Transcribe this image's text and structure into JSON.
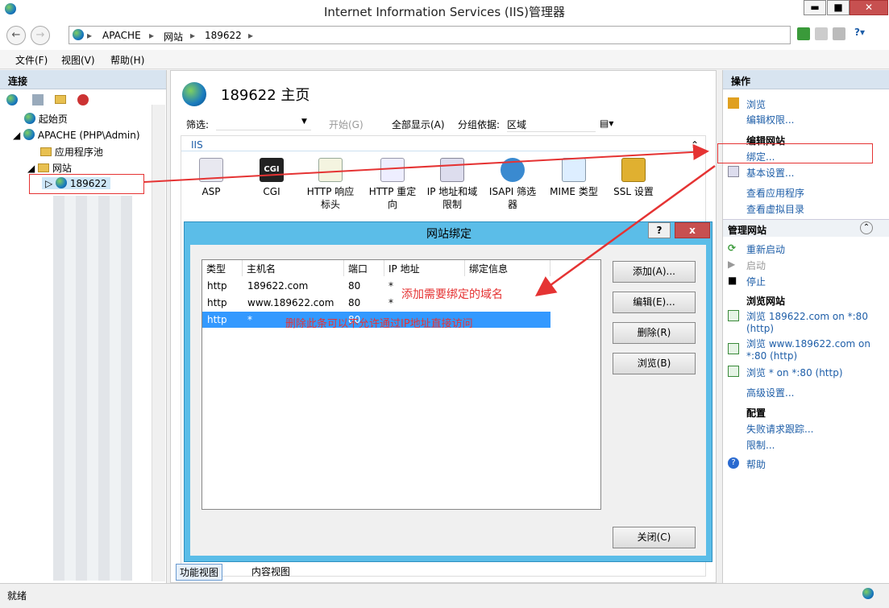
{
  "window": {
    "title": "Internet Information Services (IIS)管理器",
    "min": "▬",
    "max": "■",
    "close": "✕"
  },
  "nav": {
    "back": "←",
    "forward": "→",
    "crumbs": [
      "APACHE",
      "网站",
      "189622"
    ],
    "sep": "▸",
    "help": "?▾"
  },
  "menu": [
    "文件(F)",
    "视图(V)",
    "帮助(H)"
  ],
  "connections": {
    "header": "连接",
    "start_page": "起始页",
    "server": "APACHE (PHP\\Admin)",
    "app_pools": "应用程序池",
    "sites": "网站",
    "selected_site": "189622"
  },
  "center": {
    "title": "189622 主页",
    "filter_label": "筛选:",
    "start": "开始(G)",
    "show_all": "全部显示(A)",
    "group_by": "分组依据:",
    "group_value": "区域",
    "section": "IIS",
    "features": [
      "ASP",
      "CGI",
      "HTTP 响应标头",
      "HTTP 重定向",
      "IP 地址和域限制",
      "ISAPI 筛选器",
      "MIME 类型",
      "SSL 设置"
    ],
    "view_tabs": [
      "功能视图",
      "内容视图"
    ]
  },
  "actions": {
    "header": "操作",
    "browse": "浏览",
    "edit_perms": "编辑权限...",
    "edit_site": "编辑网站",
    "bindings": "绑定...",
    "basic_settings": "基本设置...",
    "view_apps": "查看应用程序",
    "view_vdirs": "查看虚拟目录",
    "manage_site": "管理网站",
    "restart": "重新启动",
    "start": "启动",
    "stop": "停止",
    "browse_site": "浏览网站",
    "browse1": "浏览 189622.com on *:80",
    "browse1b": "(http)",
    "browse2": "浏览 www.189622.com on",
    "browse2b": "*:80 (http)",
    "browse3": "浏览 * on *:80 (http)",
    "advanced": "高级设置...",
    "config": "配置",
    "failed_req": "失败请求跟踪...",
    "limits": "限制...",
    "help": "帮助"
  },
  "status": "就绪",
  "dialog": {
    "title": "网站绑定",
    "help": "?",
    "close_x": "x",
    "columns": [
      "类型",
      "主机名",
      "端口",
      "IP 地址",
      "绑定信息"
    ],
    "rows": [
      [
        "http",
        "189622.com",
        "80",
        "*",
        ""
      ],
      [
        "http",
        "www.189622.com",
        "80",
        "*",
        ""
      ],
      [
        "http",
        "*",
        "80",
        "",
        ""
      ]
    ],
    "buttons": [
      "添加(A)...",
      "编辑(E)...",
      "删除(R)",
      "浏览(B)"
    ],
    "close": "关闭(C)"
  },
  "annotations": {
    "add_domain": "添加需要绑定的域名",
    "delete_note": "删除此条可以不允许通过IP地址直接访问"
  }
}
